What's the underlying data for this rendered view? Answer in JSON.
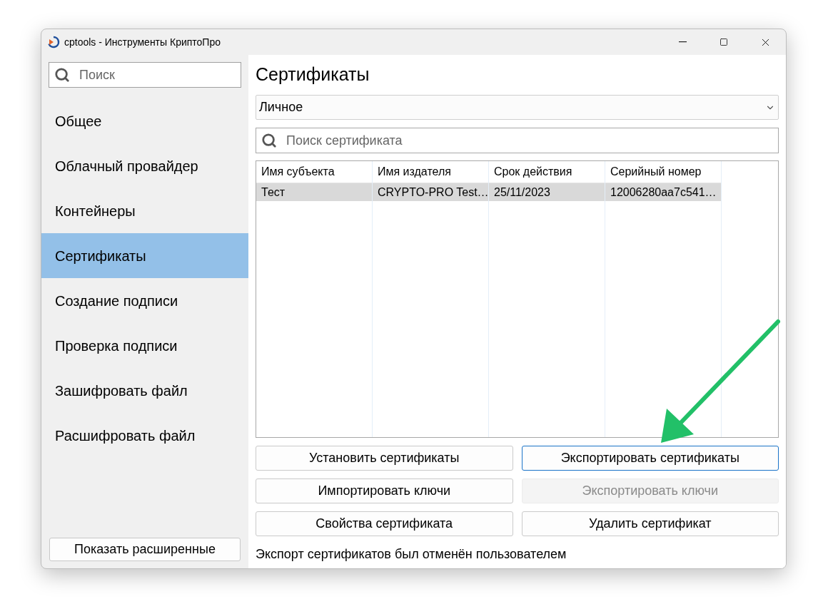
{
  "window": {
    "title": "cptools - Инструменты КриптоПро"
  },
  "sidebar": {
    "search": {
      "placeholder": "Поиск"
    },
    "items": [
      {
        "label": "Общее",
        "selected": false
      },
      {
        "label": "Облачный провайдер",
        "selected": false
      },
      {
        "label": "Контейнеры",
        "selected": false
      },
      {
        "label": "Сертификаты",
        "selected": true
      },
      {
        "label": "Создание подписи",
        "selected": false
      },
      {
        "label": "Проверка подписи",
        "selected": false
      },
      {
        "label": "Зашифровать файл",
        "selected": false
      },
      {
        "label": "Расшифровать файл",
        "selected": false
      }
    ],
    "footer_button": "Показать расширенные"
  },
  "main": {
    "title": "Сертификаты",
    "store_select": {
      "value": "Личное"
    },
    "search": {
      "placeholder": "Поиск сертификата"
    },
    "table": {
      "columns": [
        "Имя субъекта",
        "Имя издателя",
        "Срок действия",
        "Серийный номер"
      ],
      "rows": [
        {
          "cells": [
            "Тест",
            "CRYPTO-PRO Test…",
            "25/11/2023",
            "12006280aa7c541…"
          ],
          "selected": true
        }
      ]
    },
    "buttons": [
      {
        "label": "Установить сертификаты",
        "focused": false,
        "disabled": false
      },
      {
        "label": "Экспортировать сертификаты",
        "focused": true,
        "disabled": false
      },
      {
        "label": "Импортировать ключи",
        "focused": false,
        "disabled": false
      },
      {
        "label": "Экспортировать ключи",
        "focused": false,
        "disabled": true
      },
      {
        "label": "Свойства сертификата",
        "focused": false,
        "disabled": false
      },
      {
        "label": "Удалить сертификат",
        "focused": false,
        "disabled": false
      }
    ],
    "status": "Экспорт сертификатов был отменён пользователем"
  },
  "annotation": {
    "kind": "arrow",
    "color": "#22c068"
  }
}
